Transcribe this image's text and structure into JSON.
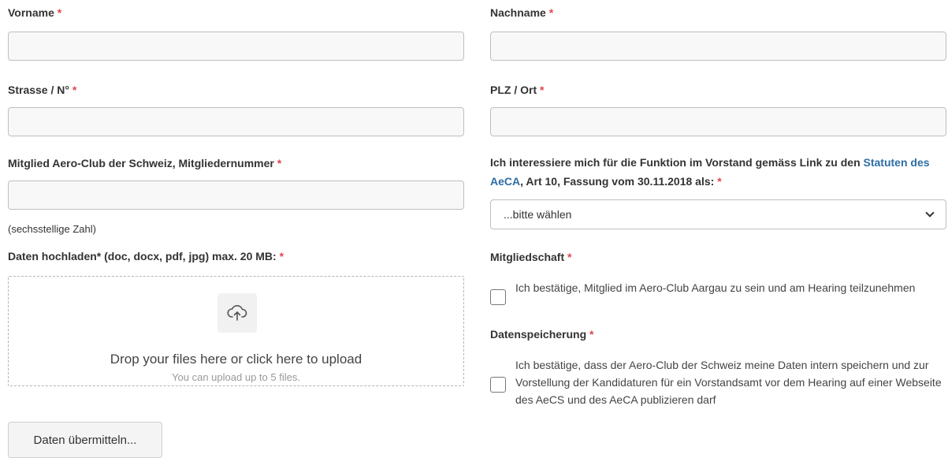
{
  "required_marker": "*",
  "form": {
    "vorname": {
      "label": "Vorname",
      "value": "",
      "placeholder": ""
    },
    "nachname": {
      "label": "Nachname",
      "value": "",
      "placeholder": ""
    },
    "strasse": {
      "label": "Strasse / N°",
      "value": "",
      "placeholder": ""
    },
    "plz_ort": {
      "label": "PLZ / Ort",
      "value": "",
      "placeholder": ""
    },
    "mitglied": {
      "label": "Mitglied Aero-Club der Schweiz, Mitgliedernummer",
      "value": "",
      "placeholder": "",
      "help": "(sechsstellige Zahl)"
    },
    "funktion": {
      "label_before": "Ich interessiere mich für die Funktion im Vorstand gemäss Link zu den ",
      "link_text": "Statuten des AeCA",
      "label_after": ", Art 10, Fassung vom 30.11.2018 als:",
      "selected": "...bitte wählen"
    },
    "upload": {
      "label": "Daten hochladen* (doc, docx, pdf, jpg) max. 20 MB:",
      "drop_text": "Drop your files here or click here to upload",
      "limit_text": "You can upload up to 5 files."
    },
    "mitgliedschaft": {
      "label": "Mitgliedschaft",
      "checkbox_text": "Ich bestätige, Mitglied im Aero-Club Aargau zu sein und am Hearing teilzunehmen",
      "checked": false
    },
    "datenspeicherung": {
      "label": "Datenspeicherung",
      "checkbox_text": "Ich bestätige, dass der Aero-Club der Schweiz meine Daten intern speichern und zur Vorstellung der Kandidaturen für ein Vorstandsamt vor dem Hearing auf einer Webseite des AeCS und des AeCA publizieren darf",
      "checked": false
    },
    "submit_label": "Daten übermitteln..."
  },
  "colors": {
    "required": "#e0474c",
    "link": "#2e6da4",
    "input_bg": "#f8f8f8"
  }
}
